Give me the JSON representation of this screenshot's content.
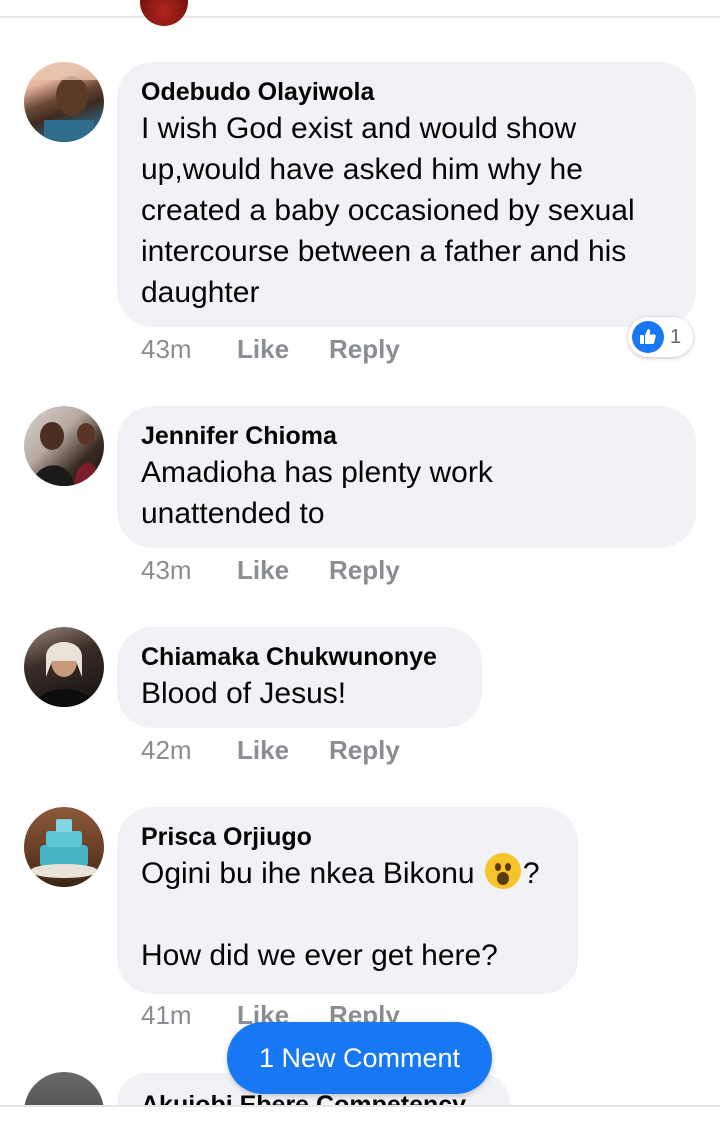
{
  "comments": [
    {
      "author": "Odebudo Olayiwola",
      "lines": [
        "I wish God exist and would show",
        "up,would have asked him why he",
        "created a baby occasioned by sexual",
        "intercourse between a father and his",
        "daughter"
      ],
      "time": "43m",
      "like_label": "Like",
      "reply_label": "Reply",
      "reaction_count": "1"
    },
    {
      "author": "Jennifer Chioma",
      "lines": [
        "Amadioha has plenty work",
        "unattended to"
      ],
      "time": "43m",
      "like_label": "Like",
      "reply_label": "Reply"
    },
    {
      "author": "Chiamaka Chukwunonye",
      "lines": [
        "Blood of Jesus!"
      ],
      "time": "42m",
      "like_label": "Like",
      "reply_label": "Reply"
    },
    {
      "author": "Prisca Orjiugo",
      "line1_before_emoji": "Ogini bu ihe nkea Bikonu ",
      "line1_after_emoji": "?",
      "emoji_name": "astonished-face",
      "line3": "How did we ever get here?",
      "time": "41m",
      "like_label": "Like",
      "reply_label": "Reply"
    },
    {
      "author": "Akujobi Ebere Competency"
    }
  ],
  "new_comment_label": "1 New Comment",
  "colors": {
    "accent": "#1877f2",
    "bubble": "#f0f2f5",
    "meta_text": "#8a8d91"
  }
}
